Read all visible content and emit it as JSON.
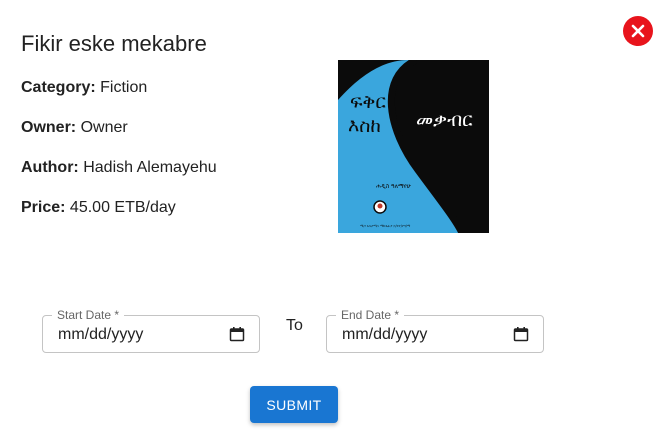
{
  "book": {
    "title": "Fikir eske mekabre",
    "category_label": "Category:",
    "category_value": "Fiction",
    "owner_label": "Owner:",
    "owner_value": "Owner",
    "author_label": "Author:",
    "author_value": "Hadish Alemayehu",
    "price_label": "Price:",
    "price_value": "45.00 ETB/day"
  },
  "cover": {
    "text_top": "ፍቅር",
    "text_mid": "እስከ",
    "text_right": "መቃብር",
    "author_small": "ሐዲስ ዓለማየሁ",
    "publisher_small": "ሜጋ አሳታሚና ማከፋፈያ ኃ/የተ/የግ/ማ",
    "color_left": "#3aa6dd",
    "color_right": "#0b0b0b"
  },
  "form": {
    "start_label": "Start Date *",
    "start_value": "mm/dd/yyyy",
    "to_label": "To",
    "end_label": "End Date *",
    "end_value": "mm/dd/yyyy",
    "submit_label": "SUBMIT"
  },
  "icons": {
    "close": "close-icon",
    "calendar": "calendar-icon"
  },
  "colors": {
    "close_bg": "#e8141c",
    "submit_bg": "#1976d2"
  }
}
